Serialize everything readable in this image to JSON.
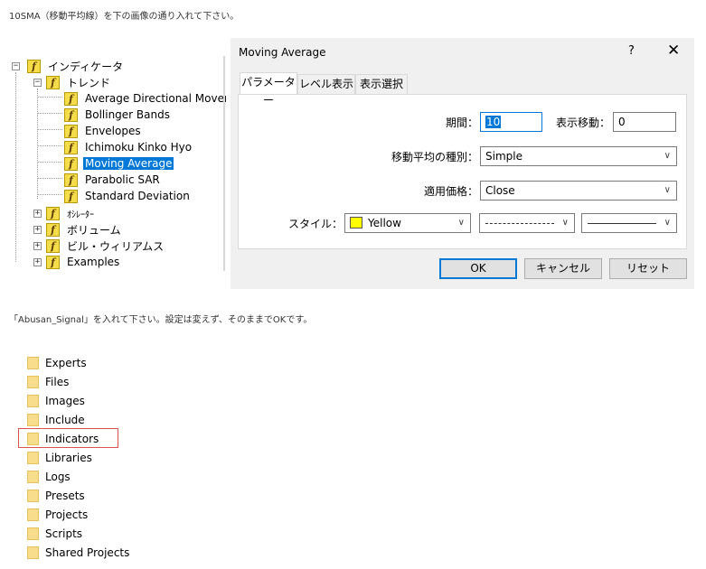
{
  "top_caption": "10SMA（移動平均線）を下の画像の通り入れて下さい。",
  "tree": {
    "root": "インディケータ",
    "trend": "トレンド",
    "trend_items": [
      "Average Directional Movemer",
      "Bollinger Bands",
      "Envelopes",
      "Ichimoku Kinko Hyo",
      "Moving Average",
      "Parabolic SAR",
      "Standard Deviation"
    ],
    "groups": [
      "ｵｼﾚｰﾀｰ",
      "ボリューム",
      "ビル・ウィリアムス",
      "Examples"
    ]
  },
  "dialog": {
    "title": "Moving Average",
    "help": "?",
    "close": "✕",
    "tabs": [
      "パラメーター",
      "レベル表示",
      "表示選択"
    ],
    "period_label": "期間：",
    "period_value": "10",
    "shift_label": "表示移動：",
    "shift_value": "0",
    "method_label": "移動平均の種別：",
    "method_value": "Simple",
    "apply_label": "適用価格：",
    "apply_value": "Close",
    "style_label": "スタイル：",
    "color_value": "Yellow",
    "color_hex": "#ffff00",
    "ok": "OK",
    "cancel": "キャンセル",
    "reset": "リセット"
  },
  "middle_caption": "「Abusan_Signal」を入れて下さい。設定は変えず、そのままでOKです。",
  "folders": [
    "Experts",
    "Files",
    "Images",
    "Include",
    "Indicators",
    "Libraries",
    "Logs",
    "Presets",
    "Projects",
    "Scripts",
    "Shared Projects"
  ],
  "highlighted_folder": "Indicators"
}
